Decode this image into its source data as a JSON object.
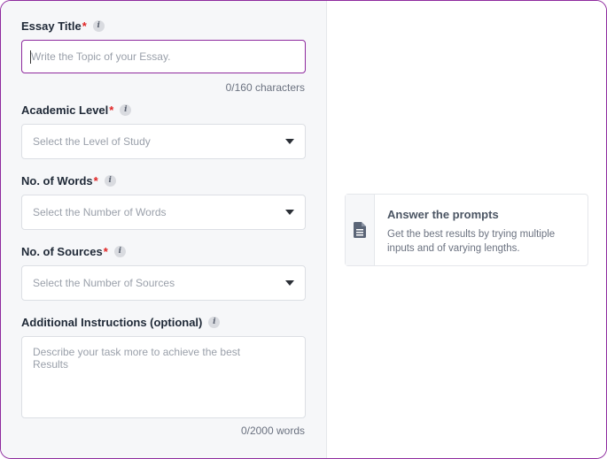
{
  "form": {
    "essay_title": {
      "label": "Essay Title",
      "required_mark": "*",
      "info_glyph": "i",
      "placeholder": "Write the Topic of your Essay.",
      "value": "",
      "counter": "0/160 characters"
    },
    "academic_level": {
      "label": "Academic Level",
      "required_mark": "*",
      "info_glyph": "i",
      "selected_text": "Select the Level of Study"
    },
    "num_words": {
      "label": "No. of Words",
      "required_mark": "*",
      "info_glyph": "i",
      "selected_text": "Select the Number of Words"
    },
    "num_sources": {
      "label": "No. of Sources",
      "required_mark": "*",
      "info_glyph": "i",
      "selected_text": "Select the Number of Sources"
    },
    "additional_instructions": {
      "label": "Additional Instructions (optional)",
      "info_glyph": "i",
      "placeholder": "Describe your task more to achieve the best\nResults",
      "counter": "0/2000 words"
    }
  },
  "tip": {
    "icon": "document-icon",
    "title": "Answer the prompts",
    "description": "Get the best results by trying multiple inputs and of varying lengths."
  },
  "colors": {
    "accent": "#8e2a9e",
    "required": "#e02424",
    "panel_bg": "#f6f7f9"
  }
}
